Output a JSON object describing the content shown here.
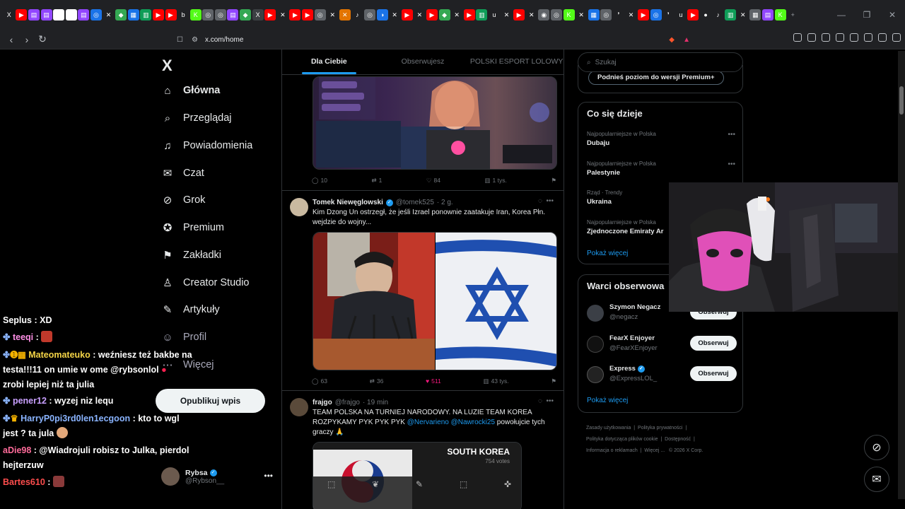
{
  "browser": {
    "url": "x.com/home",
    "tab_icons": [
      {
        "label": "X",
        "color": "#202124"
      },
      {
        "label": "▶",
        "color": "#ff0000"
      },
      {
        "label": "▤",
        "color": "#9146ff"
      },
      {
        "label": "▤",
        "color": "#9146ff"
      },
      {
        "label": "◉",
        "color": "#ffffff"
      },
      {
        "label": "✉",
        "color": "#ffffff"
      },
      {
        "label": "▤",
        "color": "#9146ff"
      },
      {
        "label": "◎",
        "color": "#1a73e8"
      },
      {
        "label": "✕",
        "color": "#202124"
      },
      {
        "label": "◆",
        "color": "#34a853"
      },
      {
        "label": "▦",
        "color": "#1a73e8"
      },
      {
        "label": "▥",
        "color": "#0f9d58"
      },
      {
        "label": "▶",
        "color": "#ff0000"
      },
      {
        "label": "▶",
        "color": "#ff0000"
      },
      {
        "label": "b",
        "color": "#202124"
      },
      {
        "label": "K",
        "color": "#53fc18"
      },
      {
        "label": "◎",
        "color": "#5f6368"
      },
      {
        "label": "◎",
        "color": "#5f6368"
      },
      {
        "label": "▤",
        "color": "#9146ff"
      },
      {
        "label": "◆",
        "color": "#34a853"
      },
      {
        "label": "X",
        "color": "#3c4043"
      },
      {
        "label": "▶",
        "color": "#ff0000"
      },
      {
        "label": "✕",
        "color": "#202124"
      },
      {
        "label": "▶",
        "color": "#ff0000"
      },
      {
        "label": "▶",
        "color": "#ff0000"
      },
      {
        "label": "◎",
        "color": "#5f6368"
      },
      {
        "label": "✕",
        "color": "#202124"
      },
      {
        "label": "✕",
        "color": "#e37400"
      },
      {
        "label": "♪",
        "color": "#202124"
      },
      {
        "label": "◎",
        "color": "#5f6368"
      },
      {
        "label": "◑",
        "color": "#1a73e8"
      },
      {
        "label": "✕",
        "color": "#202124"
      },
      {
        "label": "▶",
        "color": "#ff0000"
      },
      {
        "label": "✕",
        "color": "#202124"
      },
      {
        "label": "▶",
        "color": "#ff0000"
      },
      {
        "label": "◆",
        "color": "#34a853"
      },
      {
        "label": "✕",
        "color": "#202124"
      },
      {
        "label": "▶",
        "color": "#ff0000"
      },
      {
        "label": "▥",
        "color": "#0f9d58"
      },
      {
        "label": "u",
        "color": "#202124"
      },
      {
        "label": "✕",
        "color": "#202124"
      },
      {
        "label": "▶",
        "color": "#ff0000"
      },
      {
        "label": "✕",
        "color": "#202124"
      },
      {
        "label": "◉",
        "color": "#5f6368"
      },
      {
        "label": "◎",
        "color": "#5f6368"
      },
      {
        "label": "K",
        "color": "#53fc18"
      },
      {
        "label": "✕",
        "color": "#202124"
      },
      {
        "label": "▦",
        "color": "#1a73e8"
      },
      {
        "label": "◎",
        "color": "#5f6368"
      },
      {
        "label": "❜",
        "color": "#202124"
      },
      {
        "label": "✕",
        "color": "#202124"
      },
      {
        "label": "▶",
        "color": "#ff0000"
      },
      {
        "label": "◎",
        "color": "#1a73e8"
      },
      {
        "label": "❜",
        "color": "#202124"
      },
      {
        "label": "u",
        "color": "#202124"
      },
      {
        "label": "▶",
        "color": "#ff0000"
      },
      {
        "label": "●",
        "color": "#202124"
      },
      {
        "label": "♪",
        "color": "#202124"
      },
      {
        "label": "▥",
        "color": "#0f9d58"
      },
      {
        "label": "✕",
        "color": "#202124"
      },
      {
        "label": "▦",
        "color": "#5f6368"
      },
      {
        "label": "▤",
        "color": "#9146ff"
      },
      {
        "label": "K",
        "color": "#53fc18"
      }
    ]
  },
  "sidebar": {
    "logo": "X",
    "items": [
      {
        "label": "Główna",
        "icon": "⌂"
      },
      {
        "label": "Przeglądaj",
        "icon": "⌕"
      },
      {
        "label": "Powiadomienia",
        "icon": "♫"
      },
      {
        "label": "Czat",
        "icon": "✉"
      },
      {
        "label": "Grok",
        "icon": "⊘"
      },
      {
        "label": "Premium",
        "icon": "✪"
      },
      {
        "label": "Zakładki",
        "icon": "⚑"
      },
      {
        "label": "Creator Studio",
        "icon": "♙"
      },
      {
        "label": "Artykuły",
        "icon": "✎"
      },
      {
        "label": "Profil",
        "icon": "☺"
      },
      {
        "label": "Więcej",
        "icon": "⋯"
      }
    ],
    "post_button": "Opublikuj wpis",
    "profile": {
      "name": "Rybsa",
      "handle": "@Rybson__"
    }
  },
  "feed": {
    "tabs": [
      "Dla Ciebie",
      "Obserwujesz",
      "POLSKI ESPORT LOLOWY"
    ],
    "post0": {
      "replies": "10",
      "reposts": "1",
      "likes": "84",
      "views": "1 tys."
    },
    "post1": {
      "name": "Tomek Niewęglowski",
      "handle": "@tomek525",
      "time": "· 2 g.",
      "text": "Kim Dzong Un ostrzegł, że jeśli Izrael ponownie zaatakuje Iran, Korea Płn. wejdzie do wojny...",
      "replies": "63",
      "reposts": "36",
      "likes": "511",
      "views": "43 tys."
    },
    "post2": {
      "name": "frajgo",
      "handle": "@frajgo",
      "time": "· 19 min",
      "text_main": "TEAM POLSKA NA TURNIEJ NARODOWY. NA LUZIE TEAM KOREA ROZPYKAMY PYK PYK PYK",
      "mention1": "@Nervarieno",
      "mention2": "@Nawrocki25",
      "text_end": "powołujcie tych graczy 🙏",
      "media_title": "SOUTH KOREA",
      "media_votes": "754 votes"
    }
  },
  "right": {
    "search_placeholder": "Szukaj",
    "premium_button": "Podnieś poziom do wersji Premium+",
    "happening_title": "Co się dzieje",
    "trends": [
      {
        "meta": "Najpopularniejsze w Polska",
        "title": "Dubaju"
      },
      {
        "meta": "Najpopularniejsze w Polska",
        "title": "Palestynie"
      },
      {
        "meta": "Rząd · Trendy",
        "title": "Ukraina"
      },
      {
        "meta": "Najpopularniejsze w Polska",
        "title": "Zjednoczone Emiraty Ar"
      }
    ],
    "show_more": "Pokaż więcej",
    "who_title": "Warci obserwowa",
    "who": [
      {
        "name": "Szymon Negacz",
        "handle": "@negacz",
        "button": "Obserwuj"
      },
      {
        "name": "FearX Enjoyer",
        "handle": "@FearXEnjoyer",
        "button": "Obserwuj"
      },
      {
        "name": "Express",
        "handle": "@ExpressLOL_",
        "button": "Obserwuj"
      }
    ],
    "show_more2": "Pokaż więcej",
    "footer": [
      "Zasady użytkowania",
      "Polityka prywatności",
      "Polityka dotycząca plików cookie",
      "Dostępność",
      "Informacja o reklamach",
      "Więcej ...",
      "© 2026 X Corp."
    ]
  },
  "chat": [
    {
      "user": "Seplus",
      "color": "#ffffff",
      "msg": ": XD"
    },
    {
      "user": "teeqi",
      "color": "#ff8fe6",
      "msg": ":"
    },
    {
      "user": "Mateomateuko",
      "color": "#f5d547",
      "msg": ": weźniesz też bakbe na"
    },
    {
      "user": "",
      "color": "#ffffff",
      "msg": "testa!!!11 on umie w ome  @rybsonlol"
    },
    {
      "user": "",
      "color": "#ffffff",
      "msg": "zrobi lepiej niż ta julia"
    },
    {
      "user": "pener12",
      "color": "#c9a0ff",
      "msg": ": wyzej niz lequ"
    },
    {
      "user": "HarryP0pi3rd0len1ecgoon",
      "color": "#8ab4ff",
      "msg": ": kto to wgl"
    },
    {
      "user": "",
      "color": "#ffffff",
      "msg": "jest ? ta jula"
    },
    {
      "user": "aDie98",
      "color": "#ff6b9a",
      "msg": ": @Wiadrojuli robisz to Julka, pierdol"
    },
    {
      "user": "",
      "color": "#ffffff",
      "msg": "hejterzuw"
    },
    {
      "user": "Bartes610",
      "color": "#ff4d4d",
      "msg": ":"
    }
  ]
}
